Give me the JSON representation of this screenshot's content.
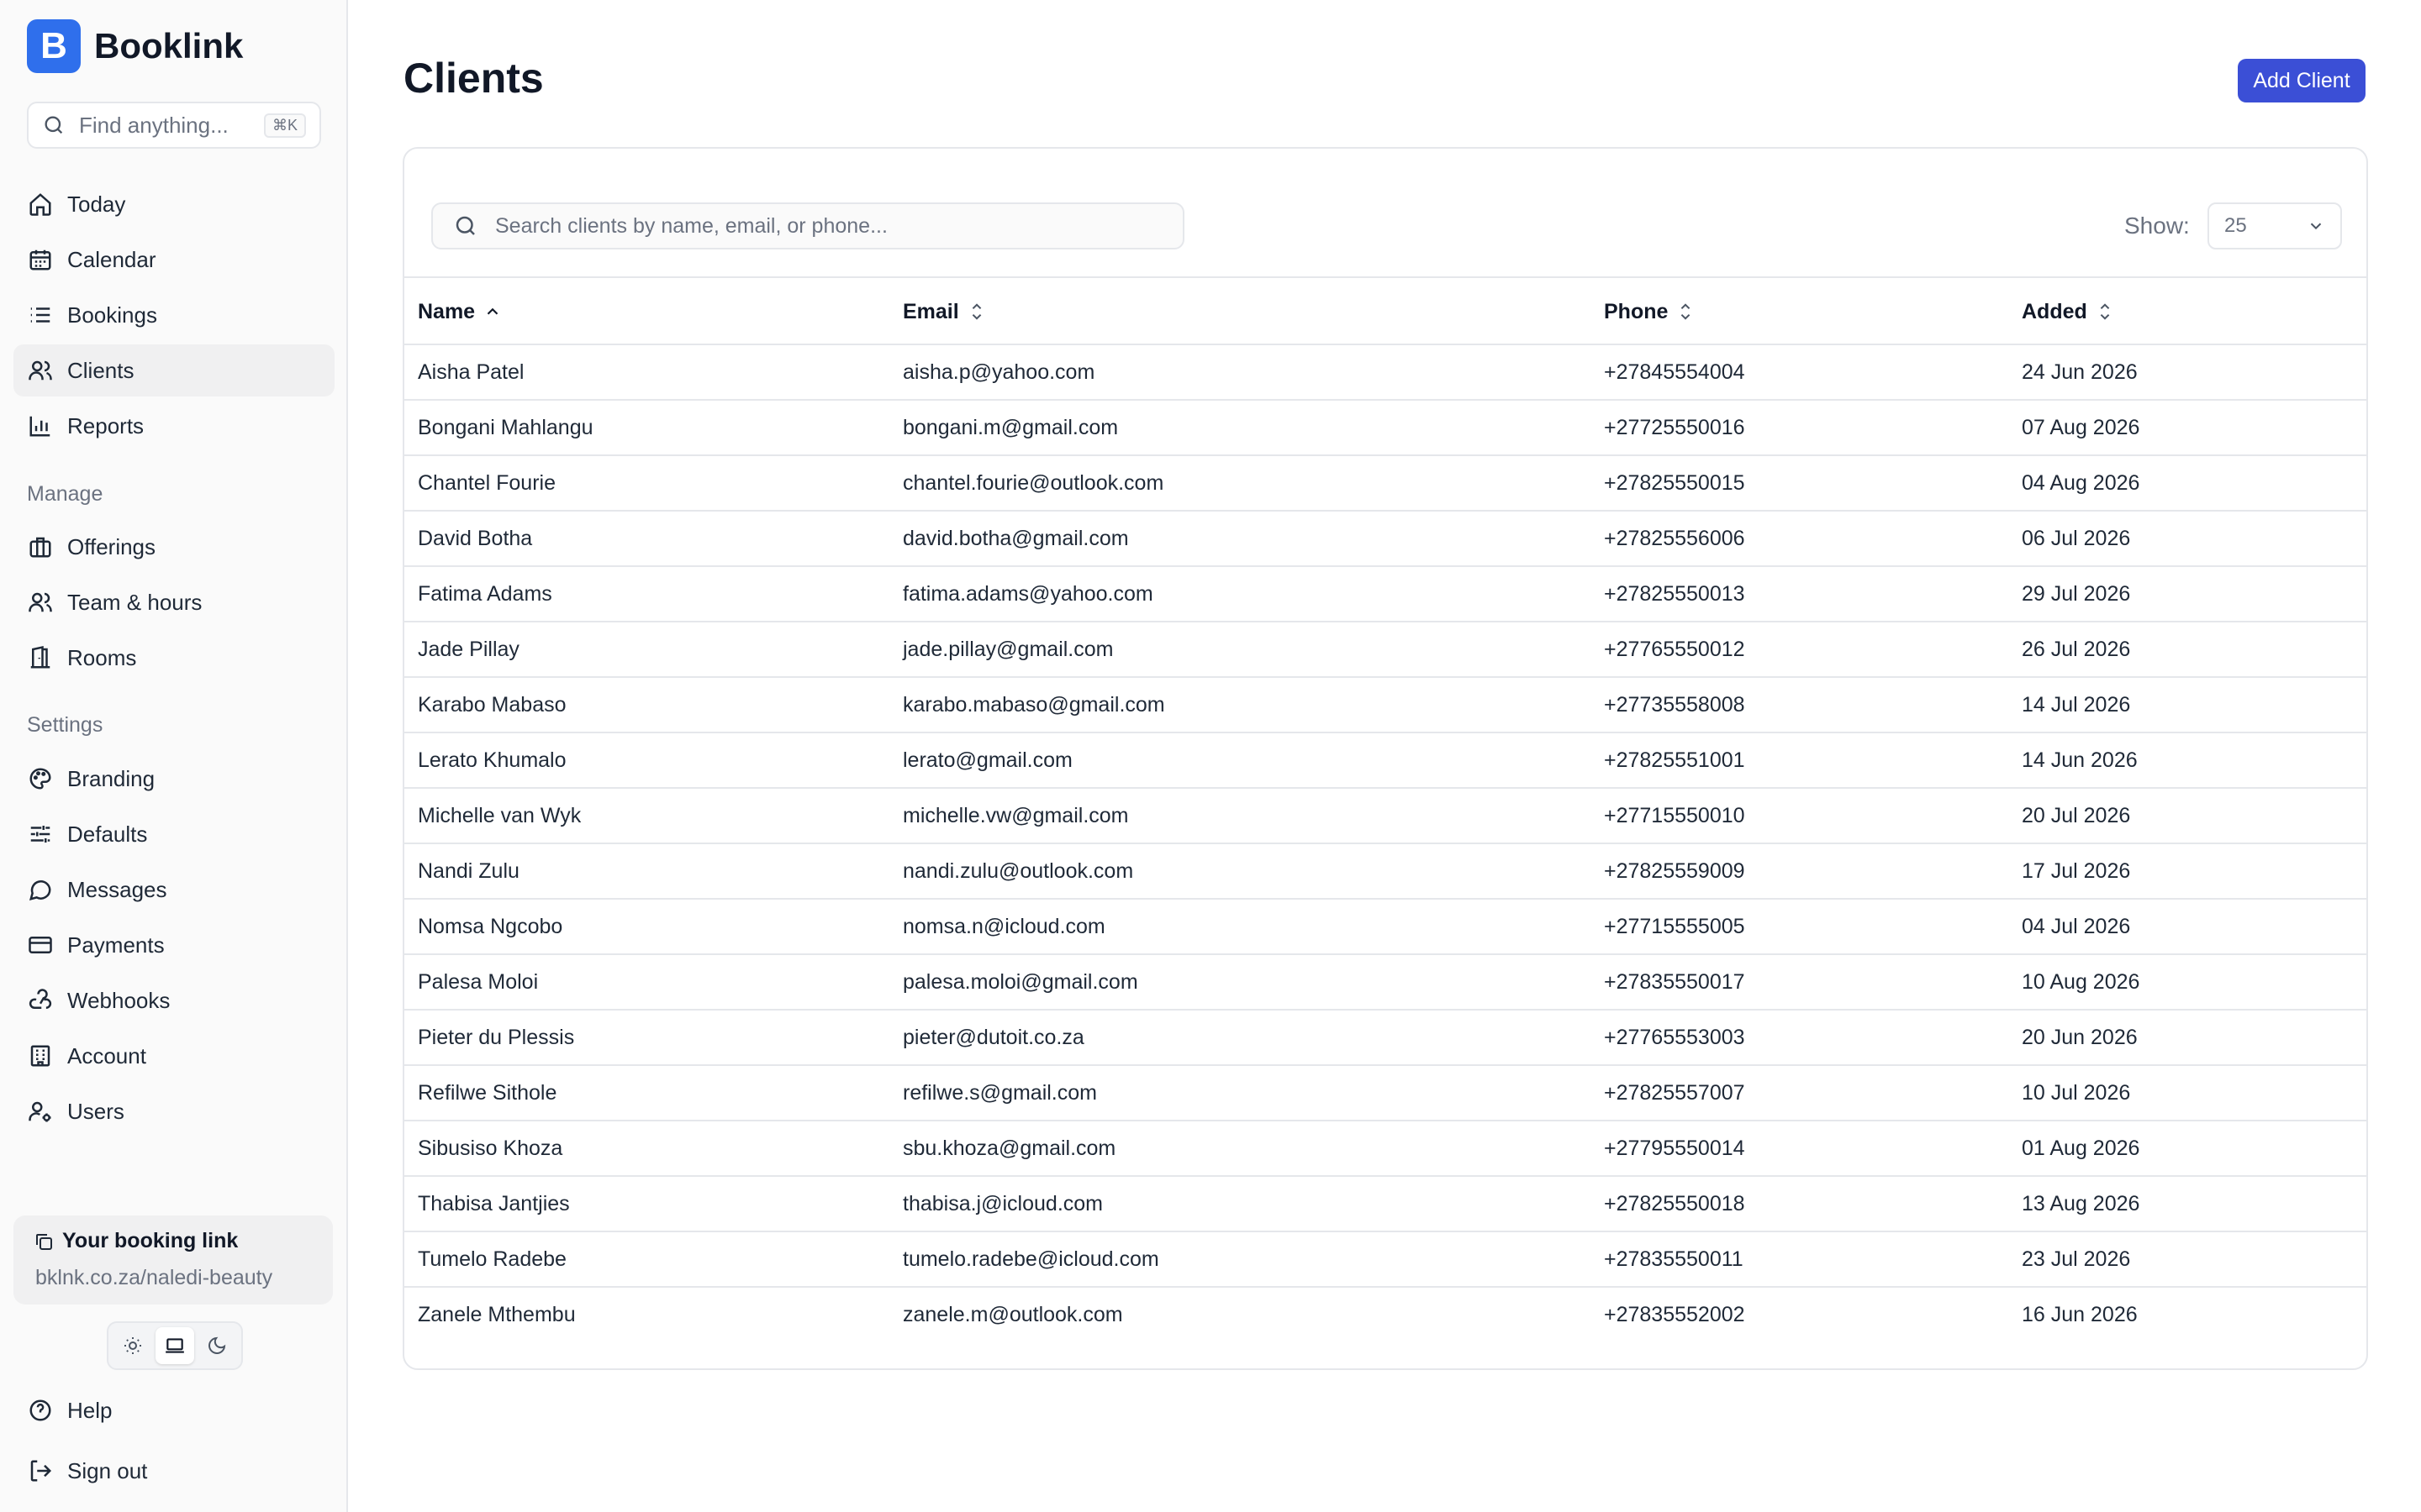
{
  "brand": {
    "logo_letter": "B",
    "name": "Booklink",
    "color": "#2f6fec"
  },
  "find": {
    "placeholder": "Find anything...",
    "shortcut": "⌘K"
  },
  "nav": {
    "items": [
      {
        "label": "Today",
        "icon": "home-icon"
      },
      {
        "label": "Calendar",
        "icon": "calendar-icon"
      },
      {
        "label": "Bookings",
        "icon": "list-icon"
      },
      {
        "label": "Clients",
        "icon": "users-icon",
        "active": true
      },
      {
        "label": "Reports",
        "icon": "bar-chart-icon"
      }
    ],
    "manage_label": "Manage",
    "manage": [
      {
        "label": "Offerings",
        "icon": "briefcase-icon"
      },
      {
        "label": "Team & hours",
        "icon": "team-icon"
      },
      {
        "label": "Rooms",
        "icon": "door-icon"
      }
    ],
    "settings_label": "Settings",
    "settings": [
      {
        "label": "Branding",
        "icon": "palette-icon"
      },
      {
        "label": "Defaults",
        "icon": "sliders-icon"
      },
      {
        "label": "Messages",
        "icon": "message-icon"
      },
      {
        "label": "Payments",
        "icon": "credit-card-icon"
      },
      {
        "label": "Webhooks",
        "icon": "webhook-icon"
      },
      {
        "label": "Account",
        "icon": "building-icon"
      },
      {
        "label": "Users",
        "icon": "user-cog-icon"
      }
    ],
    "help": "Help",
    "signout": "Sign out"
  },
  "booking_link": {
    "title": "Your booking link",
    "url": "bklnk.co.za/naledi-beauty"
  },
  "page": {
    "title": "Clients",
    "add_button": "Add Client",
    "accent": "#3b4fd6"
  },
  "search": {
    "placeholder": "Search clients by name, email, or phone..."
  },
  "show": {
    "label": "Show:",
    "value": "25"
  },
  "table": {
    "columns": [
      "Name",
      "Email",
      "Phone",
      "Added"
    ],
    "rows": [
      [
        "Aisha Patel",
        "aisha.p@yahoo.com",
        "+27845554004",
        "24 Jun 2026"
      ],
      [
        "Bongani Mahlangu",
        "bongani.m@gmail.com",
        "+27725550016",
        "07 Aug 2026"
      ],
      [
        "Chantel Fourie",
        "chantel.fourie@outlook.com",
        "+27825550015",
        "04 Aug 2026"
      ],
      [
        "David Botha",
        "david.botha@gmail.com",
        "+27825556006",
        "06 Jul 2026"
      ],
      [
        "Fatima Adams",
        "fatima.adams@yahoo.com",
        "+27825550013",
        "29 Jul 2026"
      ],
      [
        "Jade Pillay",
        "jade.pillay@gmail.com",
        "+27765550012",
        "26 Jul 2026"
      ],
      [
        "Karabo Mabaso",
        "karabo.mabaso@gmail.com",
        "+27735558008",
        "14 Jul 2026"
      ],
      [
        "Lerato Khumalo",
        "lerato@gmail.com",
        "+27825551001",
        "14 Jun 2026"
      ],
      [
        "Michelle van Wyk",
        "michelle.vw@gmail.com",
        "+27715550010",
        "20 Jul 2026"
      ],
      [
        "Nandi Zulu",
        "nandi.zulu@outlook.com",
        "+27825559009",
        "17 Jul 2026"
      ],
      [
        "Nomsa Ngcobo",
        "nomsa.n@icloud.com",
        "+27715555005",
        "04 Jul 2026"
      ],
      [
        "Palesa Moloi",
        "palesa.moloi@gmail.com",
        "+27835550017",
        "10 Aug 2026"
      ],
      [
        "Pieter du Plessis",
        "pieter@dutoit.co.za",
        "+27765553003",
        "20 Jun 2026"
      ],
      [
        "Refilwe Sithole",
        "refilwe.s@gmail.com",
        "+27825557007",
        "10 Jul 2026"
      ],
      [
        "Sibusiso Khoza",
        "sbu.khoza@gmail.com",
        "+27795550014",
        "01 Aug 2026"
      ],
      [
        "Thabisa Jantjies",
        "thabisa.j@icloud.com",
        "+27825550018",
        "13 Aug 2026"
      ],
      [
        "Tumelo Radebe",
        "tumelo.radebe@icloud.com",
        "+27835550011",
        "23 Jul 2026"
      ],
      [
        "Zanele Mthembu",
        "zanele.m@outlook.com",
        "+27835552002",
        "16 Jun 2026"
      ]
    ]
  }
}
